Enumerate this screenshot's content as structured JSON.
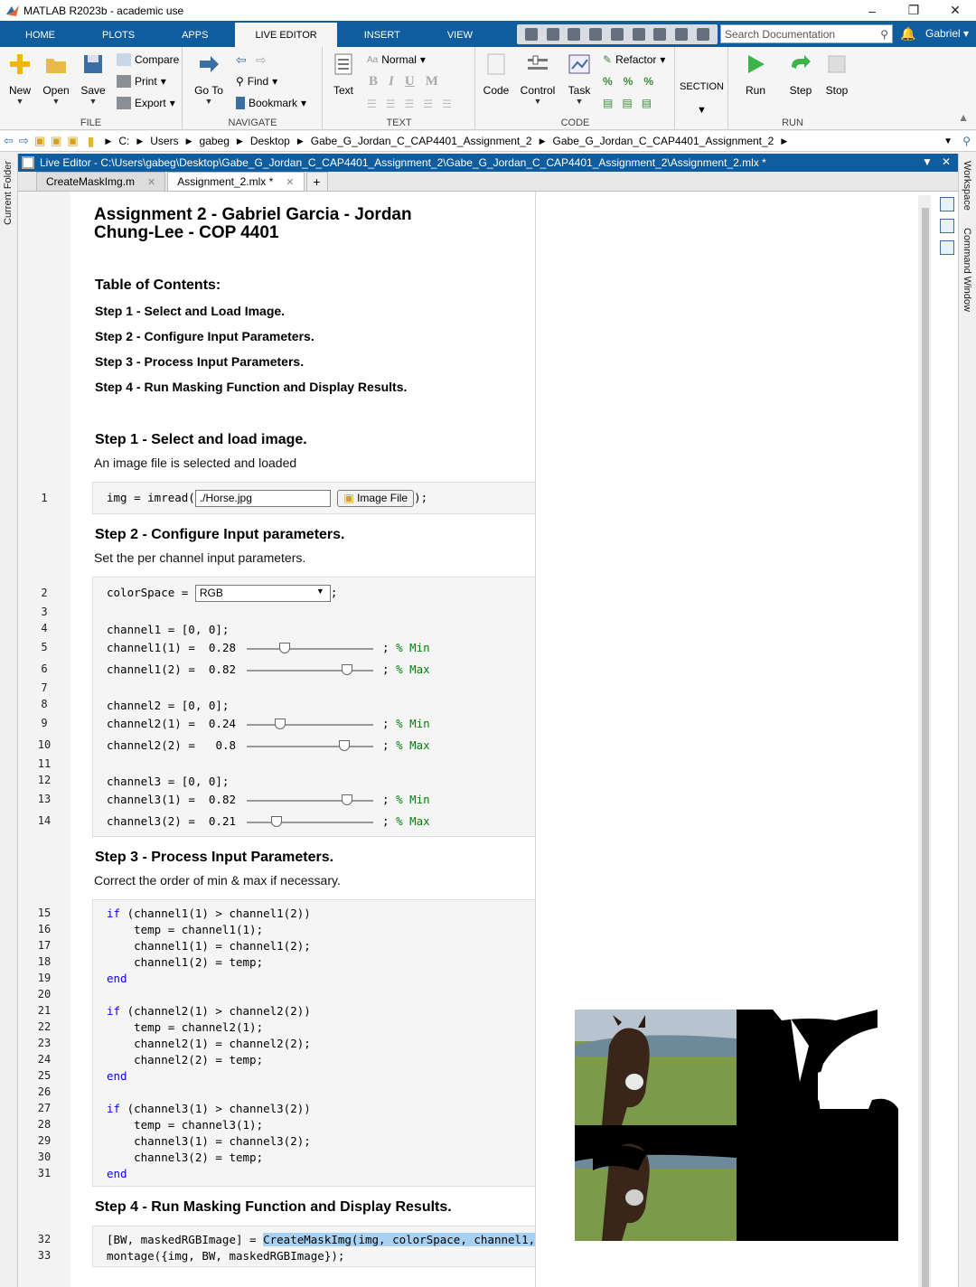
{
  "window": {
    "title": "MATLAB R2023b - academic use"
  },
  "ribbon_tabs": [
    "HOME",
    "PLOTS",
    "APPS",
    "LIVE EDITOR",
    "INSERT",
    "VIEW"
  ],
  "search": {
    "placeholder": "Search Documentation"
  },
  "user": {
    "name": "Gabriel"
  },
  "ribbon": {
    "file": {
      "label": "FILE",
      "new": "New",
      "open": "Open",
      "save": "Save",
      "compare": "Compare",
      "print": "Print",
      "export": "Export"
    },
    "navigate": {
      "label": "NAVIGATE",
      "goto": "Go To",
      "find": "Find",
      "bookmark": "Bookmark"
    },
    "text": {
      "label": "TEXT",
      "text_btn": "Text",
      "style": "Normal",
      "bold": "B",
      "italic": "I",
      "underline": "U",
      "mono": "M"
    },
    "code": {
      "label": "CODE",
      "code_btn": "Code",
      "control": "Control",
      "task": "Task",
      "refactor": "Refactor"
    },
    "section": {
      "label": "SECTION"
    },
    "run": {
      "label": "RUN",
      "run": "Run",
      "step": "Step",
      "stop": "Stop"
    }
  },
  "address": {
    "crumbs": [
      "C:",
      "Users",
      "gabeg",
      "Desktop",
      "Gabe_G_Jordan_C_CAP4401_Assignment_2",
      "Gabe_G_Jordan_C_CAP4401_Assignment_2"
    ]
  },
  "side_panels": {
    "left": "Current Folder",
    "right_top": "Workspace",
    "right_bottom": "Command Window"
  },
  "editor": {
    "title": "Live Editor - C:\\Users\\gabeg\\Desktop\\Gabe_G_Jordan_C_CAP4401_Assignment_2\\Gabe_G_Jordan_C_CAP4401_Assignment_2\\Assignment_2.mlx *",
    "tabs": [
      "CreateMaskImg.m",
      "Assignment_2.mlx *"
    ]
  },
  "doc": {
    "title": "Assignment 2 - Gabriel Garcia - Jordan Chung-Lee - COP 4401",
    "toc_heading": "Table of Contents:",
    "toc": [
      "Step 1 - Select and Load Image.",
      "Step 2 - Configure Input Parameters.",
      "Step 3 - Process Input Parameters.",
      "Step 4 - Run Masking Function and Display Results."
    ],
    "s1_heading": "Step 1 - Select and load image.",
    "s1_text": "An image file is selected and loaded",
    "s1_file": "./Horse.jpg",
    "s1_button": "Image File",
    "s2_heading": "Step 2 - Configure Input parameters.",
    "s2_text": "Set the per channel input parameters.",
    "colorspace": "RGB",
    "sliders": [
      {
        "var": "channel1(1)",
        "value": "0.28",
        "pos": 0.28,
        "comment": "% Min"
      },
      {
        "var": "channel1(2)",
        "value": "0.82",
        "pos": 0.82,
        "comment": "% Max"
      },
      {
        "var": "channel2(1)",
        "value": "0.24",
        "pos": 0.24,
        "comment": "% Min"
      },
      {
        "var": "channel2(2)",
        "value": "0.8",
        "pos": 0.8,
        "comment": "% Max"
      },
      {
        "var": "channel3(1)",
        "value": "0.82",
        "pos": 0.82,
        "comment": "% Min"
      },
      {
        "var": "channel3(2)",
        "value": "0.21",
        "pos": 0.21,
        "comment": "% Max"
      }
    ],
    "s3_heading": "Step 3 - Process Input Parameters.",
    "s3_text": "Correct the order of min & max if necessary.",
    "s4_heading": "Step 4 - Run Masking Function and Display Results."
  },
  "line_numbers": [
    "1",
    "2",
    "3",
    "4",
    "5",
    "6",
    "7",
    "8",
    "9",
    "10",
    "11",
    "12",
    "13",
    "14",
    "15",
    "16",
    "17",
    "18",
    "19",
    "20",
    "21",
    "22",
    "23",
    "24",
    "25",
    "26",
    "27",
    "28",
    "29",
    "30",
    "31",
    "32",
    "33"
  ]
}
